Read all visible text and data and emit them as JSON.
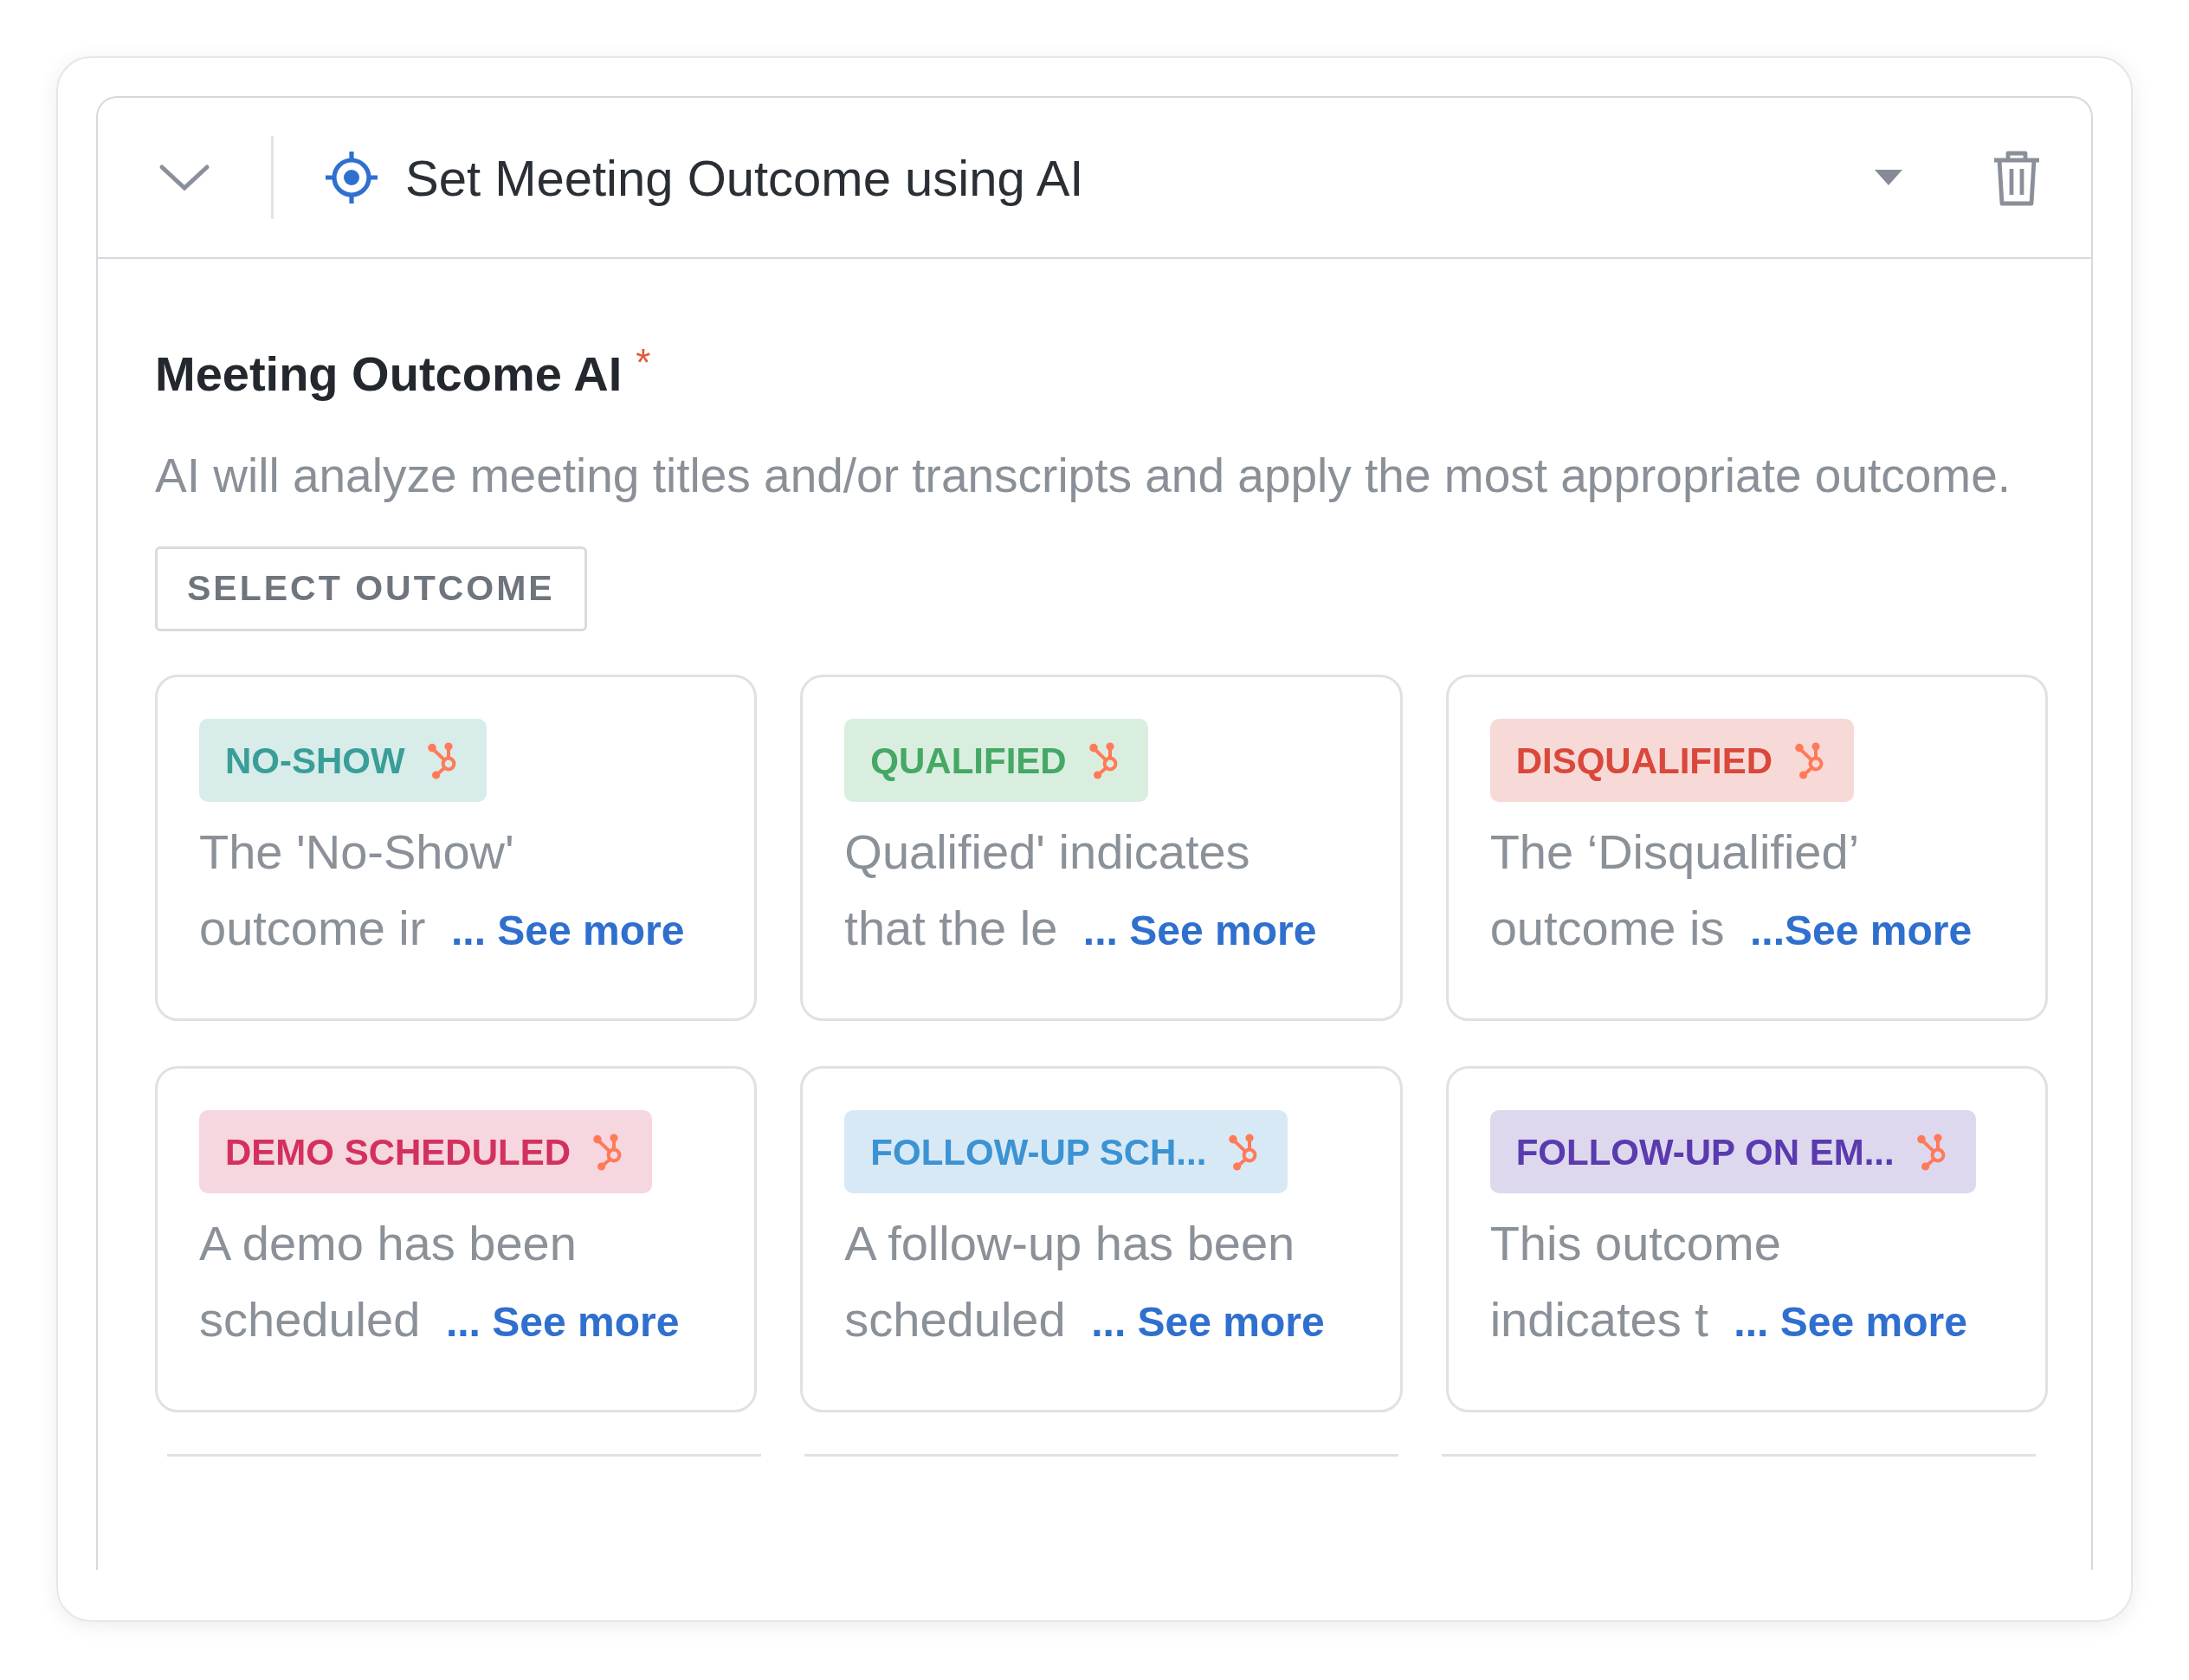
{
  "header": {
    "title": "Set Meeting Outcome using AI"
  },
  "section": {
    "title": "Meeting Outcome AI",
    "required_mark": "*",
    "description": "AI will analyze meeting titles and/or transcripts and apply the most appropriate outcome.",
    "button": "SELECT OUTCOME"
  },
  "outcomes": [
    {
      "tag": "NO-SHOW",
      "color": "#3a9e98",
      "lines": [
        "The 'No-Show'",
        "outcome ir"
      ],
      "link": "... See more"
    },
    {
      "tag": "QUALIFIED",
      "color": "#45a865",
      "lines": [
        "Qualified' indicates",
        "that the le"
      ],
      "link": "... See more"
    },
    {
      "tag": "DISQUALIFIED",
      "color": "#d9483b",
      "lines": [
        "The ‘Disqualified’",
        "outcome is"
      ],
      "link": "...See more"
    },
    {
      "tag": "DEMO SCHEDULED",
      "color": "#d3305e",
      "lines": [
        "A demo has been",
        "scheduled"
      ],
      "link": "... See more"
    },
    {
      "tag": "FOLLOW-UP SCH...",
      "color": "#3b93d3",
      "lines": [
        "A follow-up has been",
        "scheduled"
      ],
      "link": "... See more"
    },
    {
      "tag": "FOLLOW-UP ON EM...",
      "color": "#5a3aae",
      "lines": [
        "This outcome",
        "indicates t"
      ],
      "link": "... See more"
    }
  ]
}
